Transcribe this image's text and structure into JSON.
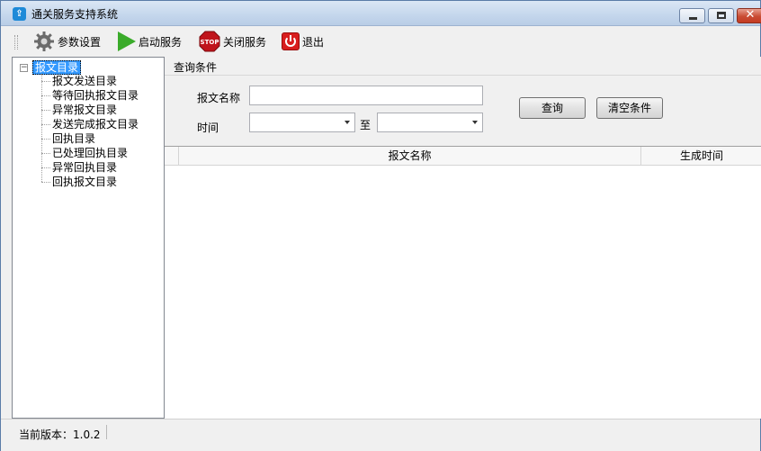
{
  "window": {
    "title": "通关服务支持系统",
    "icon": "app-icon"
  },
  "toolbar": {
    "settings_label": "参数设置",
    "start_label": "启动服务",
    "stop_label": "关闭服务",
    "stop_icon_text": "STOP",
    "exit_label": "退出"
  },
  "tree": {
    "root_label": "报文目录",
    "toggle": "−",
    "items": [
      {
        "label": "报文发送目录"
      },
      {
        "label": "等待回执报文目录"
      },
      {
        "label": "异常报文目录"
      },
      {
        "label": "发送完成报文目录"
      },
      {
        "label": "回执目录"
      },
      {
        "label": "已处理回执目录"
      },
      {
        "label": "异常回执目录"
      },
      {
        "label": "回执报文目录"
      }
    ]
  },
  "query": {
    "header": "查询条件",
    "name_label": "报文名称",
    "name_value": "",
    "time_label": "时间",
    "time_from": "",
    "to_label": "至",
    "time_to": "",
    "search_button": "查询",
    "clear_button": "清空条件"
  },
  "grid": {
    "columns": [
      "报文名称",
      "生成时间"
    ],
    "rows": []
  },
  "status": {
    "version_text": "当前版本：1.0.2"
  },
  "colors": {
    "selection": "#3399ff",
    "start_icon": "#3aab2a",
    "stop_icon": "#c0141b",
    "exit_icon": "#d81e1e"
  }
}
